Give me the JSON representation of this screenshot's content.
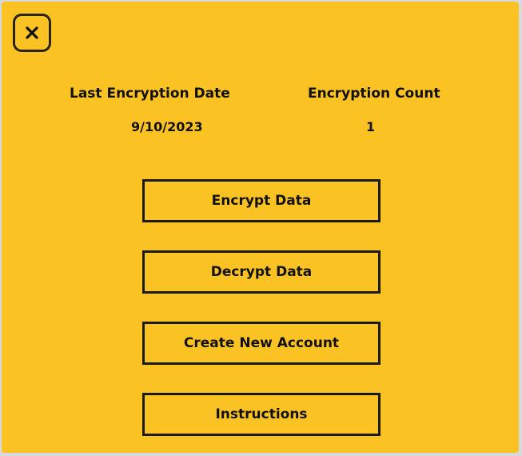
{
  "header": {
    "close_icon": "close-icon"
  },
  "stats": {
    "last_encryption_label": "Last Encryption Date",
    "last_encryption_value": "9/10/2023",
    "count_label": "Encryption Count",
    "count_value": "1"
  },
  "actions": {
    "encrypt_label": "Encrypt Data",
    "decrypt_label": "Decrypt Data",
    "create_account_label": "Create New Account",
    "instructions_label": "Instructions"
  },
  "colors": {
    "background": "#fbc223",
    "border": "#1a1a1a"
  }
}
